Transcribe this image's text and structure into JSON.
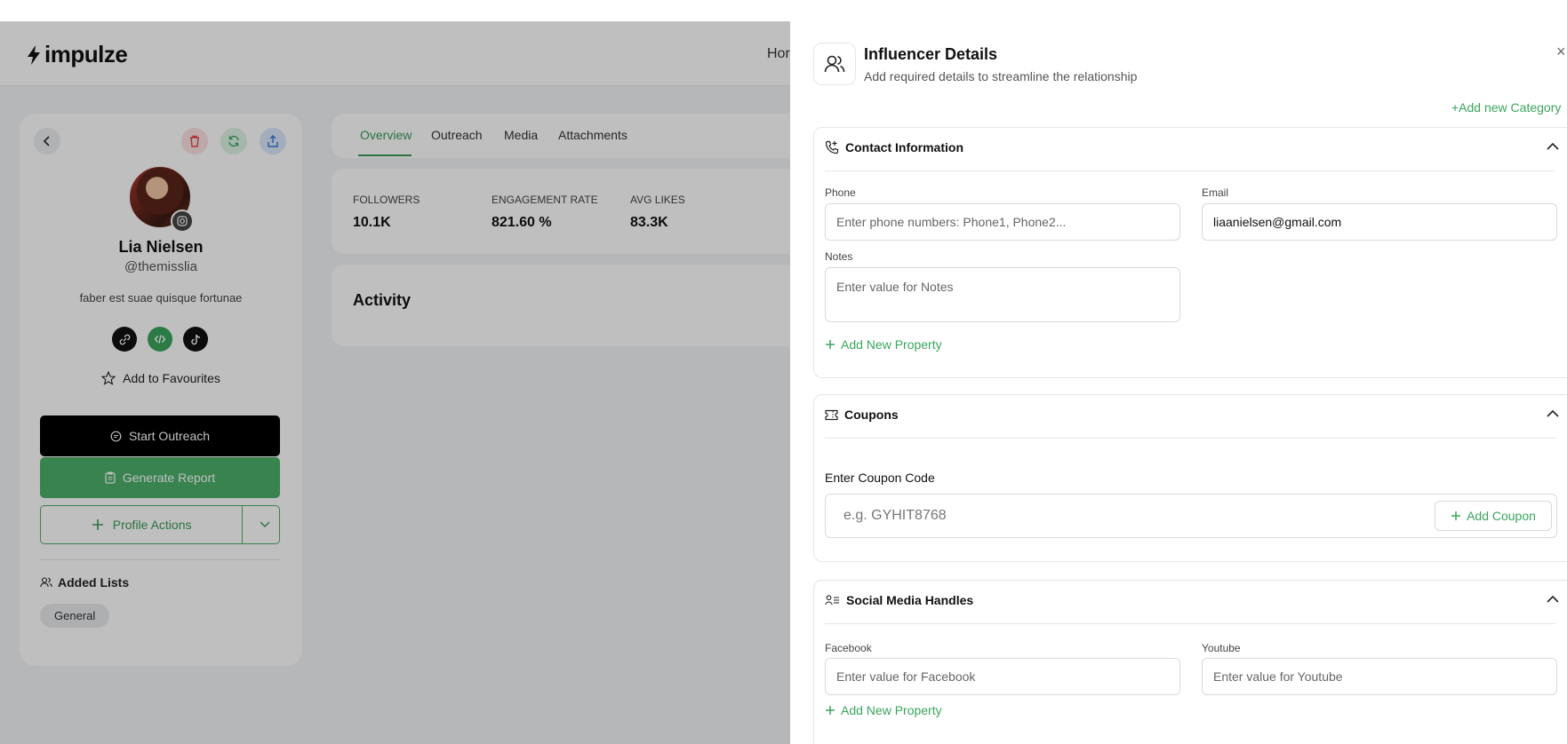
{
  "app": {
    "logo_text": "impulze",
    "nav_home": "Hor"
  },
  "profile": {
    "name": "Lia Nielsen",
    "handle": "@themisslia",
    "bio": "faber est suae quisque fortunae",
    "favourites_label": "Add to Favourites",
    "start_outreach_label": "Start Outreach",
    "generate_report_label": "Generate Report",
    "profile_actions_label": "Profile Actions",
    "added_lists_label": "Added Lists",
    "lists": [
      "General"
    ]
  },
  "tabs": [
    "Overview",
    "Outreach",
    "Media",
    "Attachments"
  ],
  "stats": [
    {
      "label": "FOLLOWERS",
      "value": "10.1K"
    },
    {
      "label": "ENGAGEMENT RATE",
      "value": "821.60 %"
    },
    {
      "label": "AVG LIKES",
      "value": "83.3K"
    }
  ],
  "activity_title": "Activity",
  "drawer": {
    "title": "Influencer Details",
    "subtitle": "Add required details to streamline the relationship",
    "close_glyph": "×",
    "add_category_label": "+Add new Category",
    "contact": {
      "title": "Contact Information",
      "phone_label": "Phone",
      "phone_placeholder": "Enter phone numbers: Phone1, Phone2...",
      "email_label": "Email",
      "email_value": "liaanielsen@gmail.com",
      "notes_label": "Notes",
      "notes_placeholder": "Enter value for Notes",
      "add_property_label": "Add New Property"
    },
    "coupons": {
      "title": "Coupons",
      "code_label": "Enter Coupon Code",
      "code_placeholder": "e.g. GYHIT8768",
      "add_coupon_label": "Add Coupon"
    },
    "social": {
      "title": "Social Media Handles",
      "facebook_label": "Facebook",
      "facebook_placeholder": "Enter value for Facebook",
      "youtube_label": "Youtube",
      "youtube_placeholder": "Enter value for Youtube",
      "add_property_label": "Add New Property"
    }
  },
  "colors": {
    "accent_green": "#3aa55d",
    "report_green": "#4caf6a",
    "overlay": "rgba(0,0,0,0.25)"
  }
}
